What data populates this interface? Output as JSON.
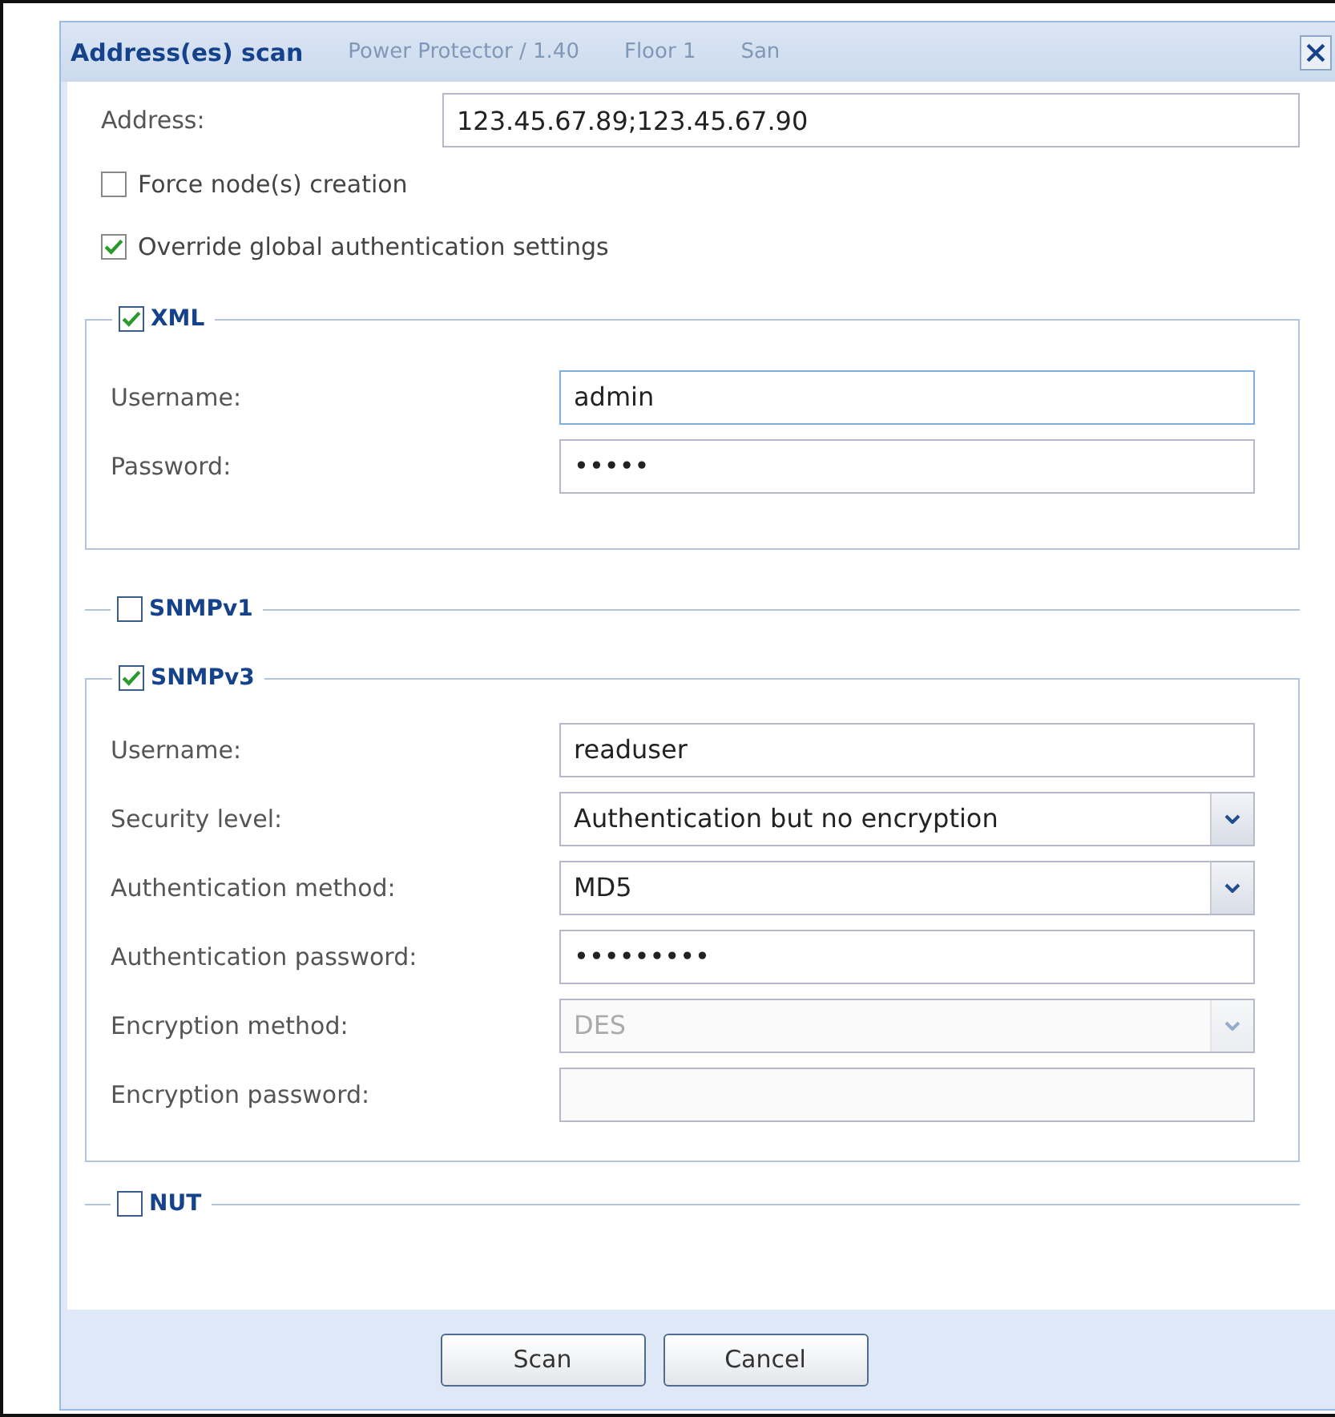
{
  "window": {
    "title": "Address(es) scan",
    "background_texts": [
      "Power Protector / 1.40",
      "Floor 1",
      "San"
    ]
  },
  "address": {
    "label": "Address:",
    "value": "123.45.67.89;123.45.67.90"
  },
  "options": [
    {
      "label": "Force node(s) creation",
      "checked": false
    },
    {
      "label": "Override global authentication settings",
      "checked": true
    }
  ],
  "groups": [
    {
      "title": "XML",
      "checked": true,
      "fields": [
        {
          "kind": "text",
          "label": "Username:",
          "value": "admin",
          "disabled": false
        },
        {
          "kind": "password",
          "label": "Password:",
          "value": "•••••",
          "disabled": false
        }
      ]
    },
    {
      "title": "SNMPv1",
      "checked": false
    },
    {
      "title": "SNMPv3",
      "checked": true,
      "fields": [
        {
          "kind": "text",
          "label": "Username:",
          "value": "readuser",
          "disabled": false
        },
        {
          "kind": "select",
          "label": "Security level:",
          "value": "Authentication but no encryption",
          "disabled": false
        },
        {
          "kind": "select",
          "label": "Authentication method:",
          "value": "MD5",
          "disabled": false
        },
        {
          "kind": "password",
          "label": "Authentication password:",
          "value": "•••••••••",
          "disabled": false
        },
        {
          "kind": "select",
          "label": "Encryption method:",
          "value": "DES",
          "disabled": true
        },
        {
          "kind": "password",
          "label": "Encryption password:",
          "disabled": true
        }
      ]
    },
    {
      "title": "NUT",
      "checked": false
    }
  ],
  "buttons": [
    "Scan",
    "Cancel"
  ]
}
